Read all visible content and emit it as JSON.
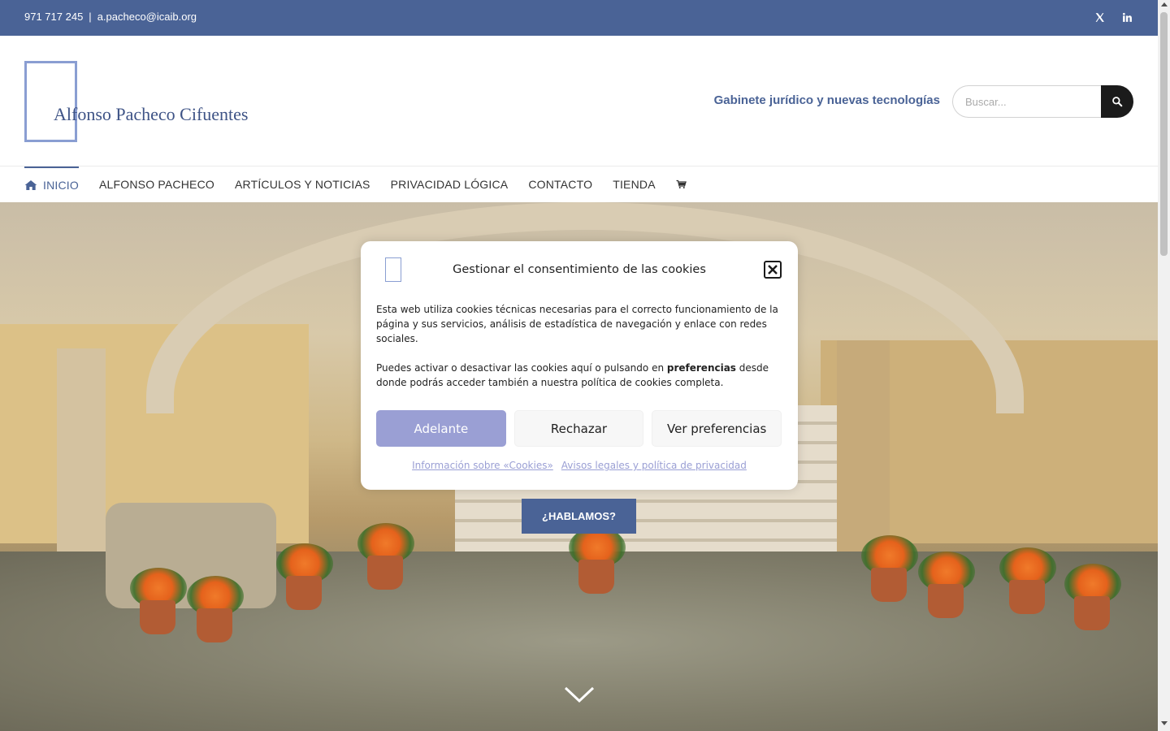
{
  "topbar": {
    "phone": "971 717 245",
    "separator": "|",
    "email": "a.pacheco@icaib.org",
    "social": [
      "x-icon",
      "linkedin-icon"
    ],
    "background": "#4a6396"
  },
  "header": {
    "logo_text": "Alfonso Pacheco Cifuentes",
    "tagline": "Gabinete jurídico y nuevas tecnologías",
    "search_placeholder": "Buscar..."
  },
  "nav": {
    "items": [
      {
        "label": "INICIO",
        "icon": "home-icon",
        "active": true
      },
      {
        "label": "ALFONSO PACHECO"
      },
      {
        "label": "ARTÍCULOS Y NOTICIAS"
      },
      {
        "label": "PRIVACIDAD LÓGICA"
      },
      {
        "label": "CONTACTO"
      },
      {
        "label": "TIENDA"
      },
      {
        "label": "",
        "icon": "cart-icon"
      }
    ],
    "accent": "#4a6396"
  },
  "hero": {
    "cta_label": "¿HABLAMOS?"
  },
  "cookie_modal": {
    "title": "Gestionar el consentimiento de las cookies",
    "paragraph1": "Esta web utiliza cookies técnicas necesarias para el correcto funcionamiento de la página y sus servicios, análisis de estadística de navegación y enlace con redes sociales.",
    "paragraph2_before": "Puedes activar o desactivar las cookies aquí o pulsando en ",
    "paragraph2_bold": "preferencias",
    "paragraph2_after": " desde donde podrás acceder también a nuestra política de cookies completa.",
    "buttons": {
      "accept": "Adelante",
      "reject": "Rechazar",
      "preferences": "Ver preferencias"
    },
    "links": {
      "cookies_info": "Información sobre «Cookies»",
      "legal": "Avisos legales y política de privacidad"
    },
    "accent": "#9a9fd4"
  }
}
